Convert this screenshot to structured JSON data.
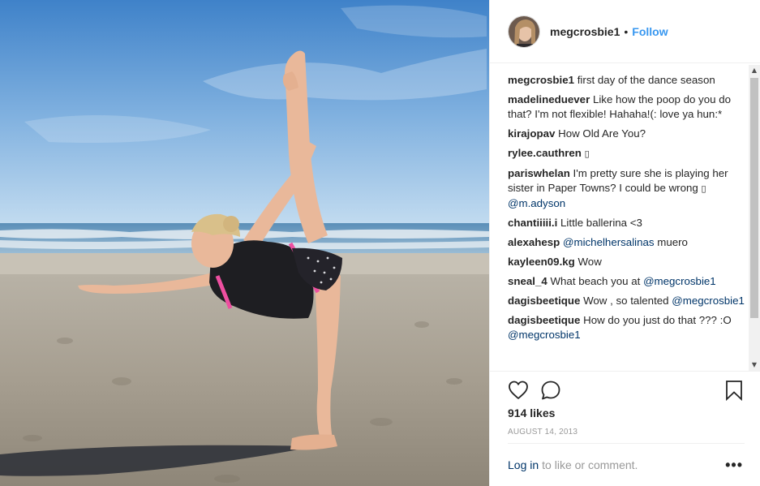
{
  "post": {
    "author": "megcrosbie1",
    "dot": "•",
    "follow_label": "Follow"
  },
  "comments": [
    {
      "user": "megcrosbie1",
      "text": " first day of the dance season"
    },
    {
      "user": "madelineduever",
      "text": " Like how the poop do you do that? I'm not flexible! Hahaha!(: love ya hun:*"
    },
    {
      "user": "kirajopav",
      "text": " How Old Are You?"
    },
    {
      "user": "rylee.cauthren",
      "text": " ",
      "glyph": "▯"
    },
    {
      "user": "pariswhelan",
      "text": " I'm pretty sure she is playing her sister in Paper Towns? I could be wrong ",
      "glyph": "▯",
      "mention": " @m.adyson"
    },
    {
      "user": "chantiiiii.i",
      "text": " Little ballerina <3"
    },
    {
      "user": "alexahesp",
      "mention": " @michelhersalinas",
      "text_after": " muero"
    },
    {
      "user": "kayleen09.kg",
      "text": " Wow"
    },
    {
      "user": "sneal_4",
      "text": " What beach you at ",
      "mention": "@megcrosbie1"
    },
    {
      "user": "dagisbeetique",
      "text": " Wow , so talented ",
      "mention": "@megcrosbie1"
    },
    {
      "user": "dagisbeetique",
      "text": " How do you just do that ??? :O ",
      "mention": "@megcrosbie1"
    }
  ],
  "icons": {
    "like": "heart-icon",
    "comment": "speech-bubble-icon",
    "save": "bookmark-icon",
    "more": "more-options-icon"
  },
  "likes_label": "914 likes",
  "date_label": "AUGUST 14, 2013",
  "footer": {
    "login_label": "Log in",
    "login_rest": "to like or comment.",
    "more_label": "•••"
  },
  "scrollbar": {
    "up_arrow": "▲",
    "down_arrow": "▼"
  },
  "colors": {
    "link_blue": "#3897f0",
    "mention_blue": "#003569",
    "muted": "#999999",
    "text": "#262626"
  }
}
